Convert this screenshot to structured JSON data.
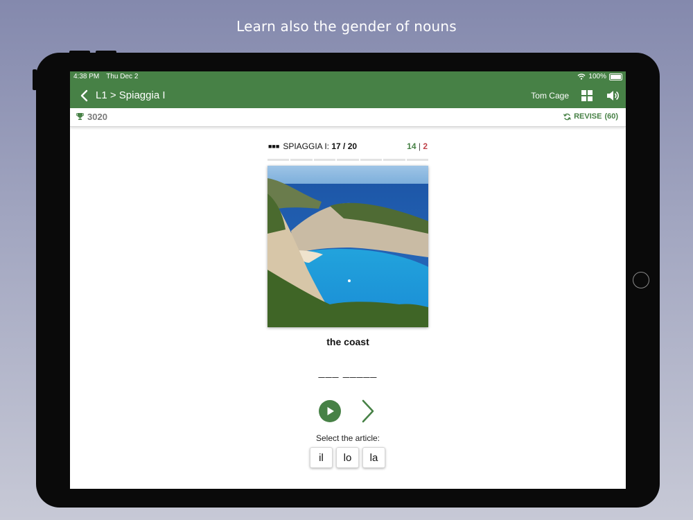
{
  "caption": "Learn also the gender of nouns",
  "status_bar": {
    "time": "4:38 PM",
    "date": "Thu Dec 2",
    "battery": "100%"
  },
  "header": {
    "breadcrumb": "L1 > Spiaggia I",
    "user_name": "Tom Cage",
    "icons": [
      "back-chevron-icon",
      "grid-icon",
      "speaker-icon"
    ],
    "accent_color": "#478146"
  },
  "subbar": {
    "score": "3020",
    "revise_label": "REVISE",
    "revise_count": "(60)"
  },
  "lesson": {
    "squares": "■■■",
    "name": "SPIAGGIA I:",
    "progress": "17 / 20",
    "correct": "14",
    "separator": "|",
    "wrong": "2",
    "segments": 7
  },
  "card": {
    "image": "coastal bay with cliffs and turquoise water",
    "word": "the coast",
    "answer_blanks": "___ _____"
  },
  "controls": {
    "icons": [
      "play-icon",
      "next-chevron-icon"
    ]
  },
  "article_select": {
    "label": "Select the article:",
    "options": [
      "il",
      "lo",
      "la"
    ]
  },
  "colors": {
    "correct": "#478146",
    "wrong": "#c0434b"
  }
}
